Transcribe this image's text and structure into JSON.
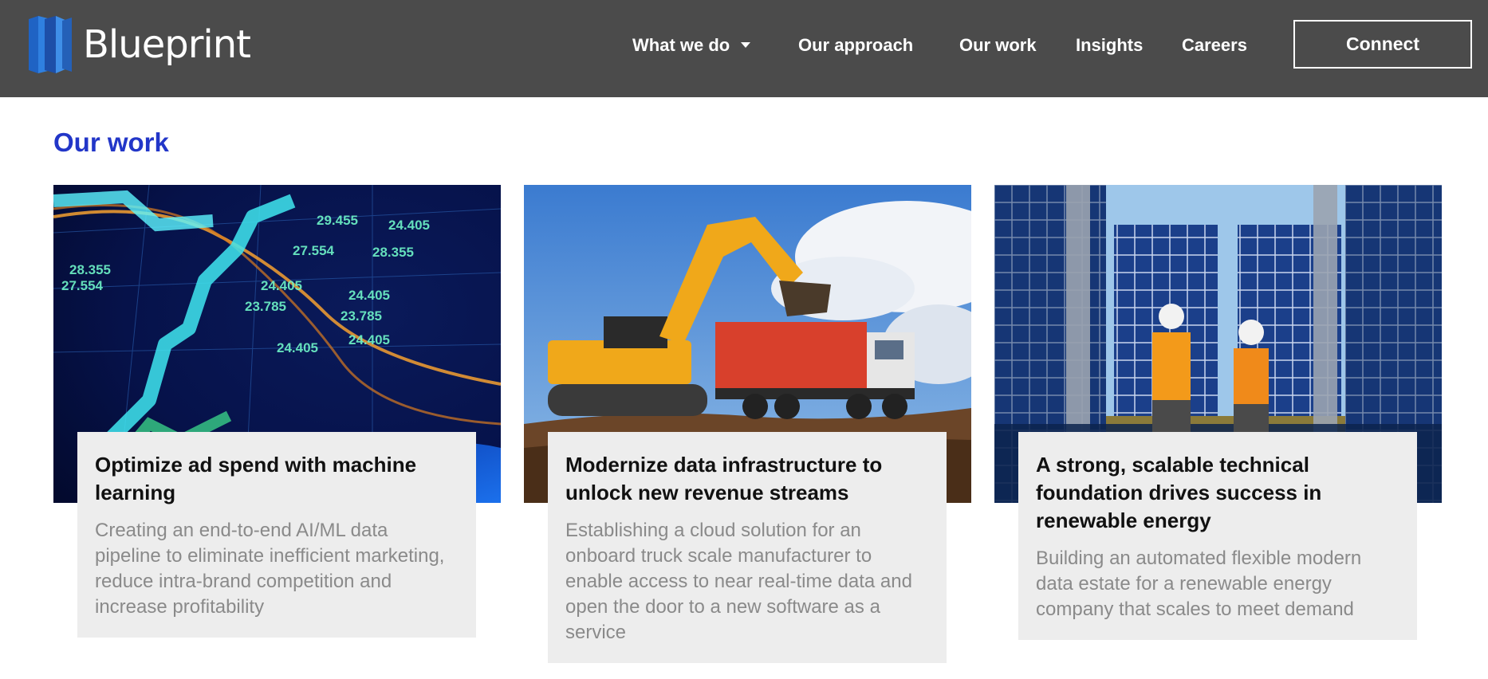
{
  "brand": {
    "name": "Blueprint"
  },
  "nav": {
    "items": [
      {
        "label": "What we do",
        "has_dropdown": true
      },
      {
        "label": "Our approach"
      },
      {
        "label": "Our work"
      },
      {
        "label": "Insights"
      },
      {
        "label": "Careers"
      }
    ],
    "connect_label": "Connect"
  },
  "section": {
    "title": "Our work"
  },
  "cards": [
    {
      "image": "stock-market-data-chart-image",
      "title": "Optimize ad spend with machine learning",
      "description": "Creating an end-to-end AI/ML data pipeline to eliminate inefficient marketing, reduce intra-brand competition and increase profitability"
    },
    {
      "image": "excavator-loading-dump-truck-image",
      "title": "Modernize data infrastructure to unlock new revenue streams",
      "description": "Establishing a cloud solution for an onboard truck scale manufacturer to enable access to near real-time data and open the door to a new software as a service"
    },
    {
      "image": "solar-panel-engineers-image",
      "title": "A strong, scalable technical foundation drives success in renewable energy",
      "description": "Building an automated flexible modern data estate for a renewable energy company that scales to meet demand"
    }
  ],
  "colors": {
    "header_bg": "#4b4b4b",
    "accent": "#2236c8",
    "card_bg": "#ededed",
    "logo_blue": "#2f80e0"
  }
}
